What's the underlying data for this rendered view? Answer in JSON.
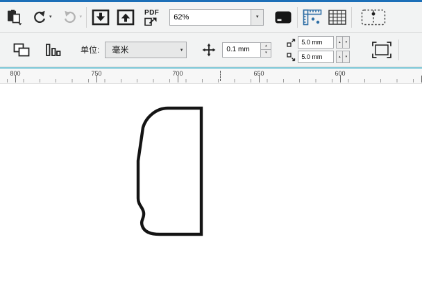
{
  "icons": {
    "chevron_down": "▾",
    "spinner_up": "▴",
    "spinner_down": "▾"
  },
  "standard_toolbar": {
    "pdf_label": "PDF",
    "zoom_value": "62%"
  },
  "property_bar": {
    "units_label": "单位:",
    "units_value": "毫米",
    "nudge_offset_value": "0.1 mm",
    "duplicate_distance_x": "5.0 mm",
    "duplicate_distance_y": "5.0 mm"
  },
  "ruler": {
    "labels": [
      "800",
      "750",
      "700",
      "650",
      "600"
    ]
  }
}
